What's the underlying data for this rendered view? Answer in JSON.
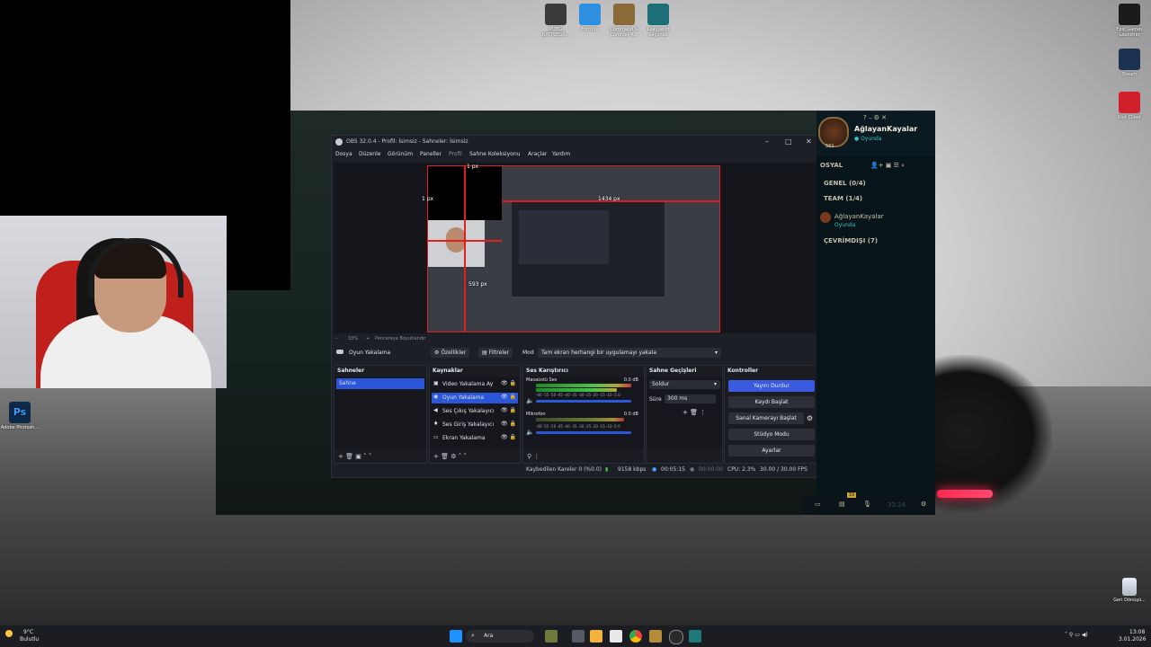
{
  "desktop_icons_top": [
    {
      "label": "PUBG BATTLEGR...",
      "color": "#3a3a3a"
    },
    {
      "label": "Fortnite",
      "color": "#2d8fe0"
    },
    {
      "label": "Command & Conquer R...",
      "color": "#8b6a3a"
    },
    {
      "label": "League of Legends",
      "color": "#1e6e78"
    }
  ],
  "desktop_icons_right": [
    {
      "label": "Epic Games Launcher",
      "color": "#1b1b1b"
    },
    {
      "label": "Steam",
      "color": "#1b3350"
    },
    {
      "label": "Riot Client",
      "color": "#d1202c"
    }
  ],
  "desktop_icon_left": {
    "label": "Adobe Photosh...",
    "color": "#0e2a4a",
    "glyph": "Ps"
  },
  "desktop_icon_recycle": {
    "label": "Geri Dönüşü..."
  },
  "obs": {
    "title": "OBS 32.0.4 - Profil: İsimsiz - Sahneler: İsimsiz",
    "menu": [
      "Dosya",
      "Düzenle",
      "Görünüm",
      "Paneller",
      "Profil",
      "Sahne Koleksiyonu",
      "Araçlar",
      "Yardım"
    ],
    "preview_labels": {
      "top": "1 px",
      "left": "1 px",
      "right": "1434 px",
      "bottom": "593 px"
    },
    "zoom_bar": {
      "zoom": "33%",
      "fit": "Pencereye Boyutlandır"
    },
    "source_toolbar": {
      "source_name": "Oyun Yakalama",
      "properties": "Özellikler",
      "filters": "Filtreler",
      "mode_label": "Mod",
      "mode_value": "Tam ekran herhangi bir uygulamayı yakala"
    },
    "scenes": {
      "title": "Sahneler",
      "items": [
        "Sahne"
      ]
    },
    "sources": {
      "title": "Kaynaklar",
      "items": [
        "Video Yakalama Ay",
        "Oyun Yakalama",
        "Ses Çıkış Yakalayıcı",
        "Ses Giriş Yakalayıcı",
        "Ekran Yakalama"
      ]
    },
    "mixer": {
      "title": "Ses Karıştırıcı",
      "channels": [
        {
          "name": "Masaüstü Ses",
          "db": "0.0 dB"
        },
        {
          "name": "Mikrofon",
          "db": "0.0 dB"
        }
      ],
      "scale": "-60 -55 -50 -45 -40 -35 -30 -25 -20 -15 -10 -5 0"
    },
    "transitions": {
      "title": "Sahne Geçişleri",
      "type": "Soldur",
      "duration_label": "Süre",
      "duration": "300 ms"
    },
    "controls": {
      "title": "Kontroller",
      "buttons": [
        "Yayını Durdur",
        "Kaydı Başlat",
        "Sanal Kamerayı Başlat",
        "Stüdyo Modu",
        "Ayarlar"
      ]
    },
    "status": {
      "dropped": "Kaybedilen Kareler 0 (%0.0)",
      "kbps": "9158 kbps",
      "live_time": "00:05:15",
      "rec_time": "00:00:00",
      "cpu": "CPU: 2.3%",
      "fps": "30.00 / 30.00 FPS"
    }
  },
  "riot": {
    "username": "AğlayanKayalar",
    "status": "Oyunda",
    "level": "561",
    "section": "OSYAL",
    "groups": [
      "GENEL (0/4)",
      "TEAM (1/4)"
    ],
    "friend": {
      "name": "AğlayanKayalar",
      "status": "Oyunda"
    },
    "offline": "ÇEVRİMDIŞI (7)",
    "footer_badge": "10",
    "footer_time": "33:24"
  },
  "taskbar": {
    "weather": "9°C",
    "weather_sub": "Bulutlu",
    "search": "Ara",
    "time": "13:08",
    "date": "3.01.2026"
  }
}
